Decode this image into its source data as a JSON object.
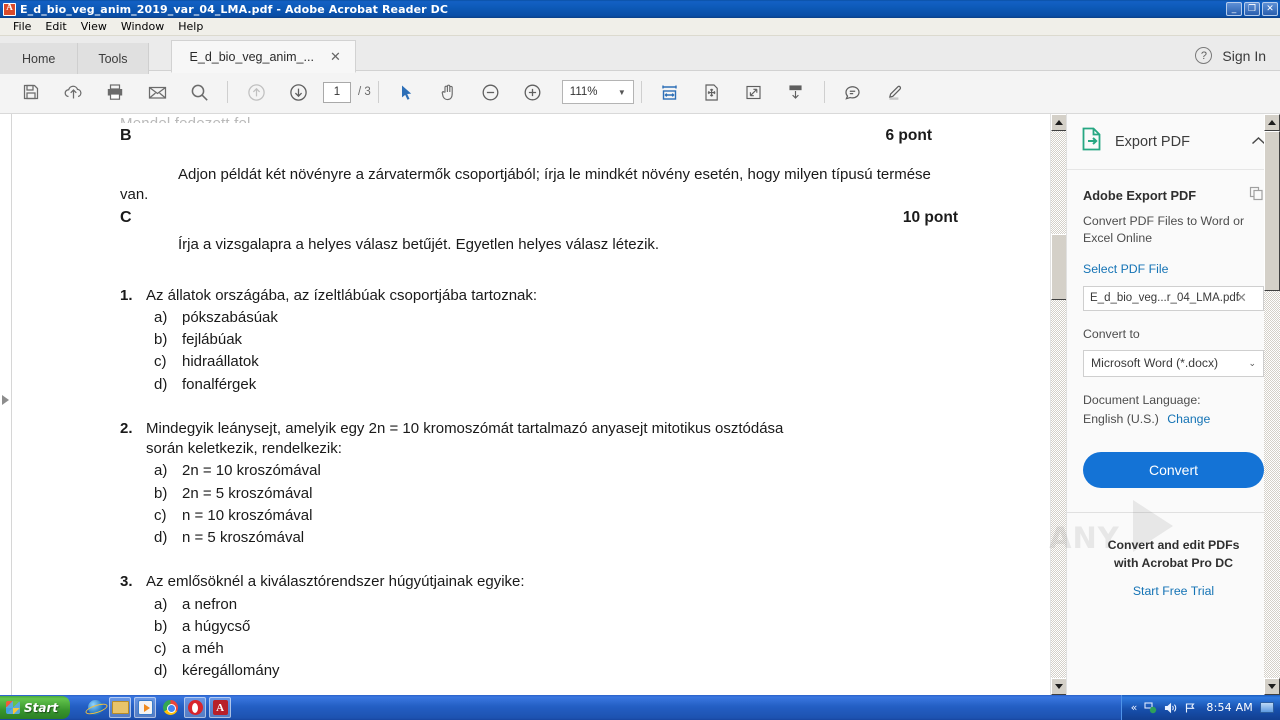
{
  "window": {
    "title": "E_d_bio_veg_anim_2019_var_04_LMA.pdf - Adobe Acrobat Reader DC",
    "minimize": "_",
    "maximize": "❐",
    "close": "✕"
  },
  "menubar": {
    "items": [
      "File",
      "Edit",
      "View",
      "Window",
      "Help"
    ]
  },
  "tabs": {
    "home": "Home",
    "tools": "Tools",
    "document": "E_d_bio_veg_anim_...",
    "close_glyph": "✕"
  },
  "account": {
    "help_glyph": "?",
    "sign_in": "Sign In"
  },
  "toolbar": {
    "page_current": "1",
    "page_total": "/ 3",
    "zoom_value": "111%",
    "zoom_caret": "▼"
  },
  "document": {
    "cut_top": "Mendel fedezett fel.",
    "sections": [
      {
        "letter": "B",
        "points": "6 pont"
      },
      {
        "letter": "C",
        "points": "10 pont"
      }
    ],
    "para_b": "Adjon példát két növényre a zárvatermők csoportjából; írja le mindkét növény esetén, hogy milyen típusú termése van.",
    "para_c": "Írja a vizsgalapra a helyes válasz betűjét. Egyetlen helyes válasz létezik.",
    "questions": [
      {
        "num": "1.",
        "text": "Az állatok országába, az ízeltlábúak csoportjába tartoznak:",
        "text_cont": "",
        "options": [
          {
            "label": "a)",
            "text": "pókszabásúak"
          },
          {
            "label": "b)",
            "text": "fejlábúak"
          },
          {
            "label": "c)",
            "text": "hidraállatok"
          },
          {
            "label": "d)",
            "text": "fonalférgek"
          }
        ]
      },
      {
        "num": "2.",
        "text": "Mindegyik leánysejt, amelyik egy 2n = 10 kromoszómát tartalmazó anyasejt mitotikus osztódása",
        "text_cont": "során keletkezik, rendelkezik:",
        "options": [
          {
            "label": "a)",
            "text": "2n = 10 kroszómával"
          },
          {
            "label": "b)",
            "text": "2n = 5 kroszómával"
          },
          {
            "label": "c)",
            "text": "n = 10 kroszómával"
          },
          {
            "label": "d)",
            "text": "n = 5 kroszómával"
          }
        ]
      },
      {
        "num": "3.",
        "text": "Az emlősöknél a  kiválasztórendszer húgyútjainak egyike:",
        "text_cont": "",
        "options": [
          {
            "label": "a)",
            "text": "a nefron"
          },
          {
            "label": "b)",
            "text": "a húgycső"
          },
          {
            "label": "c)",
            "text": "a méh"
          },
          {
            "label": "d)",
            "text": "kéregállomány"
          }
        ]
      }
    ]
  },
  "panel": {
    "header_title": "Export PDF",
    "collapse_glyph": "⌃",
    "heading": "Adobe Export PDF",
    "subtitle": "Convert PDF Files to Word or Excel Online",
    "select_file_link": "Select PDF File",
    "file_value": "E_d_bio_veg...r_04_LMA.pdf",
    "file_clear_glyph": "✕",
    "convert_to_label": "Convert to",
    "format_value": "Microsoft Word (*.docx)",
    "format_caret": "⌄",
    "language_label": "Document Language:",
    "language_value": "English (U.S.)",
    "language_change": "Change",
    "convert_button": "Convert",
    "promo_line1": "Convert and edit PDFs",
    "promo_line2": "with Acrobat Pro DC",
    "promo_link": "Start Free Trial",
    "watermark": "ANY"
  },
  "taskbar": {
    "start": "Start",
    "clock": "8:54 AM",
    "tray_expand": "«",
    "quicklaunch": [
      "internet-explorer",
      "file-explorer",
      "media-player",
      "chrome",
      "opera",
      "acrobat-reader"
    ]
  },
  "colors": {
    "accent_blue": "#1473d6",
    "link_blue": "#1473b5",
    "titlebar_blue": "#0d5ab8",
    "export_green": "#26a782"
  }
}
